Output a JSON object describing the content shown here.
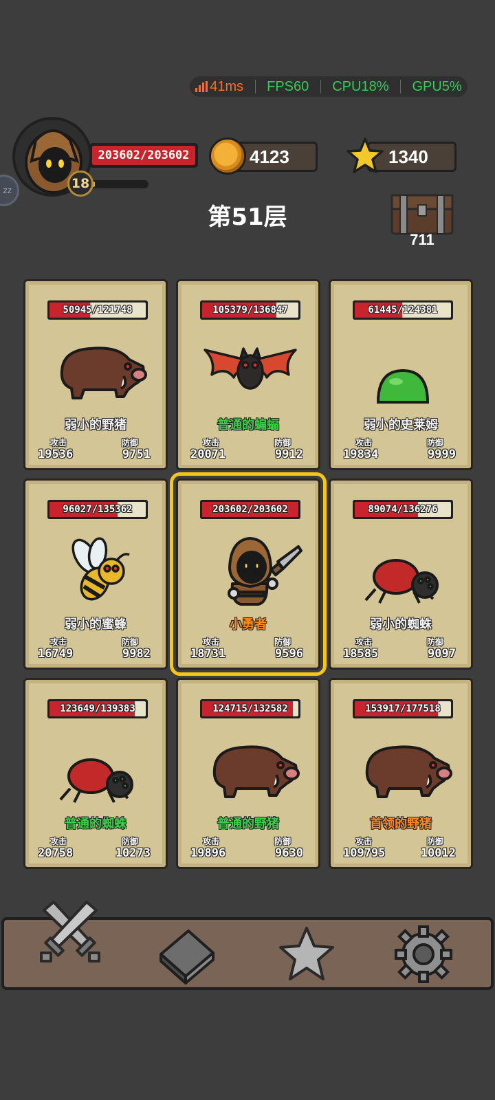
{
  "perf": {
    "ping": "41ms",
    "fps": "FPS60",
    "cpu": "CPU18%",
    "gpu": "GPU5%"
  },
  "player": {
    "hp": "203602/203602",
    "level": "18",
    "xp_fraction": 0.05
  },
  "resources": {
    "gold": "4123",
    "stars": "1340"
  },
  "floor": {
    "title": "第51层"
  },
  "chest": {
    "count": "711"
  },
  "labels": {
    "attack": "攻击",
    "defense": "防御"
  },
  "colors": {
    "hp_red": "#c8242d",
    "selected_border": "#f5c518",
    "normal_green": "#3ccf4a",
    "hero_orange": "#ff8a1c"
  },
  "cards": [
    {
      "hp": "50945/121748",
      "hp_fraction": 0.418,
      "name": "弱小的野猪",
      "tier": "weak",
      "attack": "19536",
      "defense": "9751",
      "icon": "boar-icon"
    },
    {
      "hp": "105379/136847",
      "hp_fraction": 0.77,
      "name": "普通的蝙蝠",
      "tier": "normal",
      "attack": "20071",
      "defense": "9912",
      "icon": "bat-icon"
    },
    {
      "hp": "61445/124381",
      "hp_fraction": 0.494,
      "name": "弱小的史莱姆",
      "tier": "weak",
      "attack": "19834",
      "defense": "9999",
      "icon": "slime-icon"
    },
    {
      "hp": "96027/135362",
      "hp_fraction": 0.709,
      "name": "弱小的蜜蜂",
      "tier": "weak",
      "attack": "16749",
      "defense": "9982",
      "icon": "bee-icon"
    },
    {
      "hp": "203602/203602",
      "hp_fraction": 1.0,
      "name": "小勇者",
      "tier": "hero",
      "attack": "18731",
      "defense": "9596",
      "icon": "hero-icon",
      "selected": true
    },
    {
      "hp": "89074/136276",
      "hp_fraction": 0.654,
      "name": "弱小的蜘蛛",
      "tier": "weak",
      "attack": "18585",
      "defense": "9097",
      "icon": "spider-icon"
    },
    {
      "hp": "123649/139383",
      "hp_fraction": 0.887,
      "name": "普通的蜘蛛",
      "tier": "normal",
      "attack": "20758",
      "defense": "10273",
      "icon": "spider-icon"
    },
    {
      "hp": "124715/132582",
      "hp_fraction": 0.941,
      "name": "普通的野猪",
      "tier": "normal",
      "attack": "19896",
      "defense": "9630",
      "icon": "boar-icon"
    },
    {
      "hp": "153917/177518",
      "hp_fraction": 0.867,
      "name": "首领的野猪",
      "tier": "boss",
      "attack": "109795",
      "defense": "10012",
      "icon": "boar-icon"
    }
  ],
  "nav": [
    {
      "icon": "crossed-swords-icon"
    },
    {
      "icon": "book-icon"
    },
    {
      "icon": "star-icon"
    },
    {
      "icon": "gear-icon"
    }
  ]
}
